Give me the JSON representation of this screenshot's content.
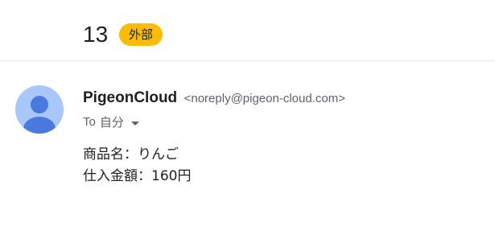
{
  "subject": {
    "title": "13",
    "label": "外部",
    "label_color": "#fbbc04"
  },
  "sender": {
    "avatar_icon": "person-icon",
    "avatar_bg": "#a8c7fa",
    "avatar_fg": "#4a7ae0",
    "name": "PigeonCloud",
    "email": "<noreply@pigeon-cloud.com>"
  },
  "recipient": {
    "prefix": "To",
    "name": "自分",
    "dropdown_icon": "caret-down-icon"
  },
  "body": {
    "lines": [
      "商品名：りんご",
      "仕入金額：160円"
    ]
  }
}
